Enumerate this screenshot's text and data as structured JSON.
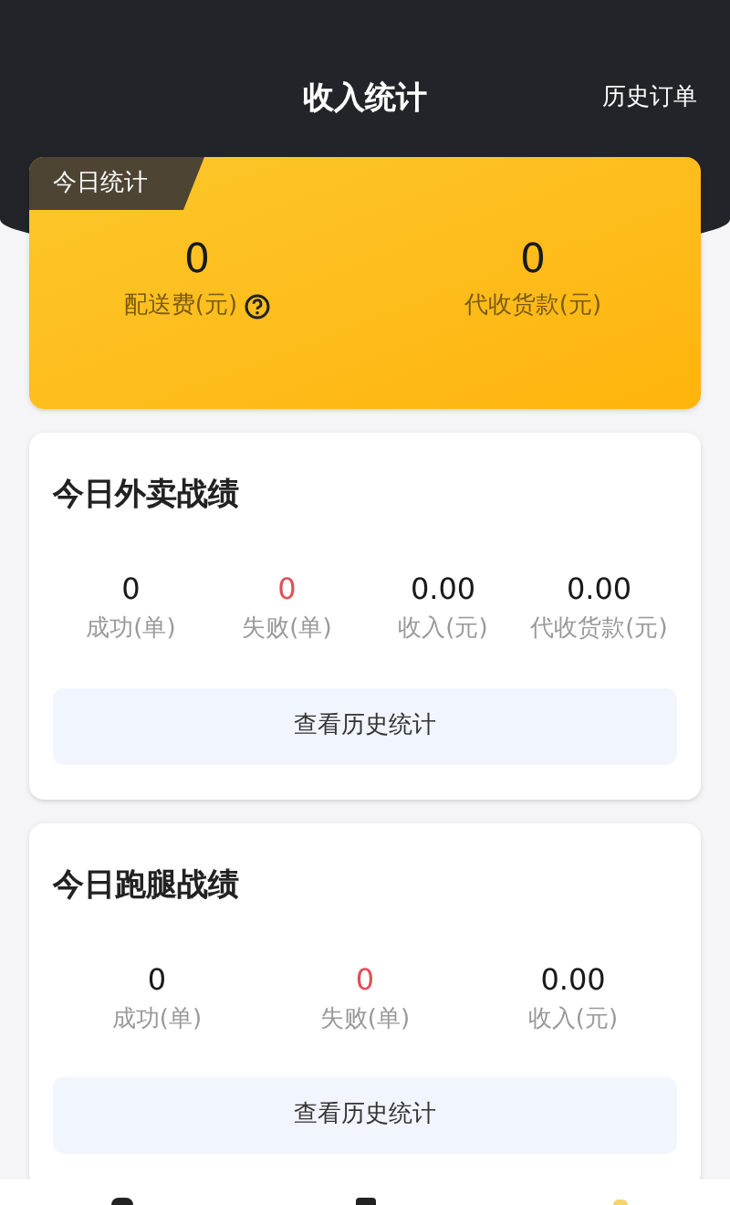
{
  "header": {
    "title": "收入统计",
    "action": "历史订单"
  },
  "today": {
    "badge": "今日统计",
    "stats": [
      {
        "value": "0",
        "label": "配送费(元)",
        "help": true
      },
      {
        "value": "0",
        "label": "代收货款(元)",
        "help": false
      }
    ]
  },
  "sections": [
    {
      "title": "今日外卖战绩",
      "stats": [
        {
          "value": "0",
          "label": "成功(单)",
          "kind": "count"
        },
        {
          "value": "0",
          "label": "失败(单)",
          "kind": "failure"
        },
        {
          "value": "0.00",
          "label": "收入(元)",
          "kind": "count"
        },
        {
          "value": "0.00",
          "label": "代收货款(元)",
          "kind": "count"
        }
      ],
      "button": "查看历史统计"
    },
    {
      "title": "今日跑腿战绩",
      "stats": [
        {
          "value": "0",
          "label": "成功(单)",
          "kind": "count"
        },
        {
          "value": "0",
          "label": "失败(单)",
          "kind": "failure"
        },
        {
          "value": "0.00",
          "label": "收入(元)",
          "kind": "count"
        }
      ],
      "button": "查看历史统计"
    }
  ]
}
